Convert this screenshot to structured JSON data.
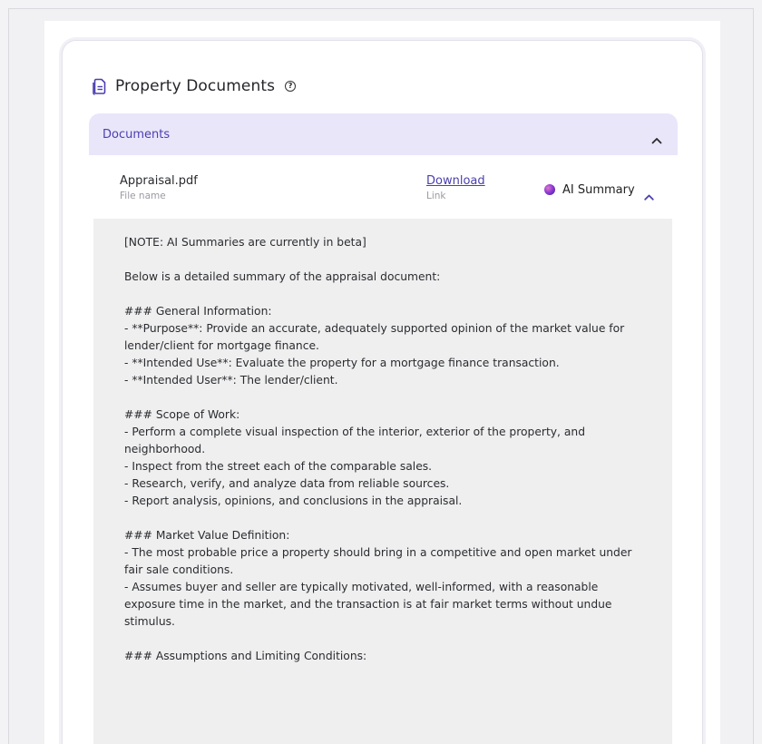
{
  "card": {
    "title": "Property Documents",
    "help_glyph": "?"
  },
  "accordion": {
    "label": "Documents"
  },
  "file": {
    "name": "Appraisal.pdf",
    "name_caption": "File name",
    "link_label": "Download",
    "link_caption": "Link",
    "ai_summary_label": "AI Summary"
  },
  "summary": {
    "beta_note": "[NOTE: AI Summaries are currently in beta]",
    "intro": "Below is a detailed summary of the appraisal document:",
    "general_heading": "### General Information:",
    "general_1": "- **Purpose**: Provide an accurate, adequately supported opinion of the market value for lender/client for mortgage finance.",
    "general_2": "- **Intended Use**: Evaluate the property for a mortgage finance transaction.",
    "general_3": "- **Intended User**: The lender/client.",
    "scope_heading": "### Scope of Work:",
    "scope_1": "- Perform a complete visual inspection of the interior, exterior of the property, and neighborhood.",
    "scope_2": "- Inspect from the street each of the comparable sales.",
    "scope_3": "- Research, verify, and analyze data from reliable sources.",
    "scope_4": "- Report analysis, opinions, and conclusions in the appraisal.",
    "market_heading": "### Market Value Definition:",
    "market_1": "- The most probable price a property should bring in a competitive and open market under fair sale conditions.",
    "market_2": "- Assumes buyer and seller are typically motivated, well-informed, with a reasonable exposure time in the market, and the transaction is at fair market terms without undue stimulus.",
    "assumptions_heading": "### Assumptions and Limiting Conditions:"
  },
  "colors": {
    "accent": "#4b3fae",
    "accordion_bg": "#e9e6fa",
    "summary_bg": "#efefef"
  }
}
